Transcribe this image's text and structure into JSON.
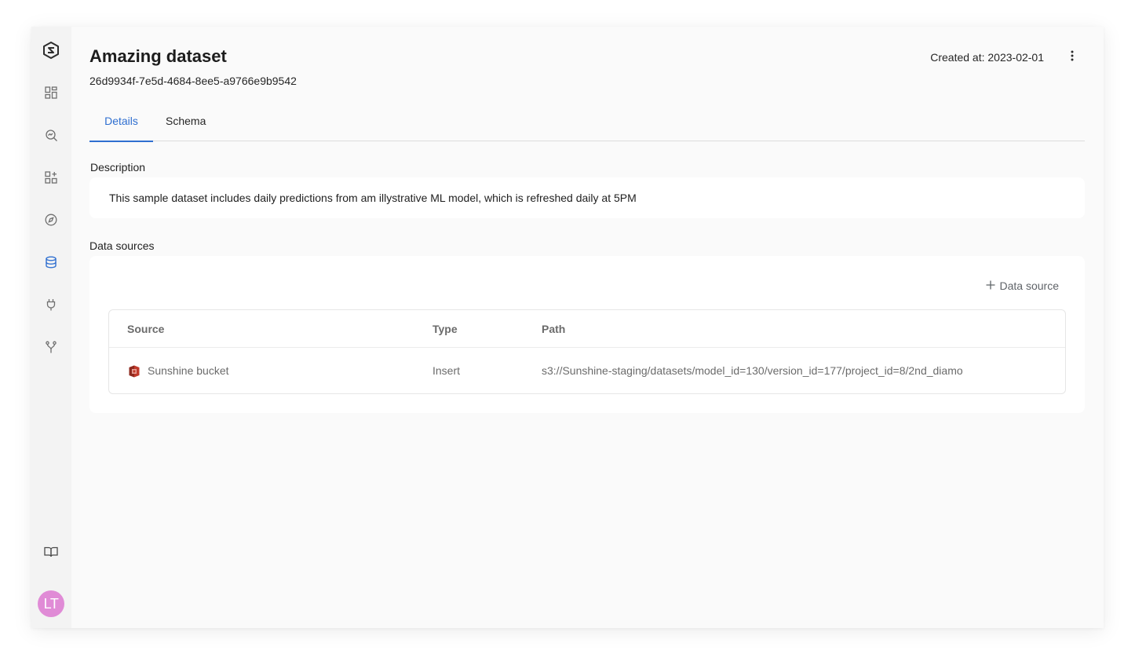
{
  "sidebar": {
    "logo_icon": "logo-icon",
    "items": [
      {
        "icon": "dashboard-icon",
        "active": false
      },
      {
        "icon": "search-analytics-icon",
        "active": false
      },
      {
        "icon": "add-widget-icon",
        "active": false
      },
      {
        "icon": "compass-icon",
        "active": false
      },
      {
        "icon": "database-icon",
        "active": true
      },
      {
        "icon": "plug-icon",
        "active": false
      },
      {
        "icon": "branch-icon",
        "active": false
      }
    ],
    "docs_icon": "book-icon",
    "avatar_initials": "LT",
    "avatar_color": "#e08bd6",
    "active_color": "#2f6fd0"
  },
  "header": {
    "title": "Amazing dataset",
    "id": "26d9934f-7e5d-4684-8ee5-a9766e9b9542",
    "created_at": "Created at: 2023-02-01",
    "menu_icon": "kebab-menu-icon"
  },
  "tabs": [
    {
      "label": "Details",
      "active": true
    },
    {
      "label": "Schema",
      "active": false
    }
  ],
  "description": {
    "label": "Description",
    "text": "This sample dataset includes daily predictions from am illystrative ML model, which is refreshed daily at 5PM"
  },
  "data_sources": {
    "label": "Data sources",
    "add_button": "Data source",
    "columns": [
      "Source",
      "Type",
      "Path"
    ],
    "rows": [
      {
        "icon": "s3-bucket-icon",
        "source": "Sunshine bucket",
        "type": "Insert",
        "path": "s3://Sunshine-staging/datasets/model_id=130/version_id=177/project_id=8/2nd_diamo"
      }
    ]
  }
}
